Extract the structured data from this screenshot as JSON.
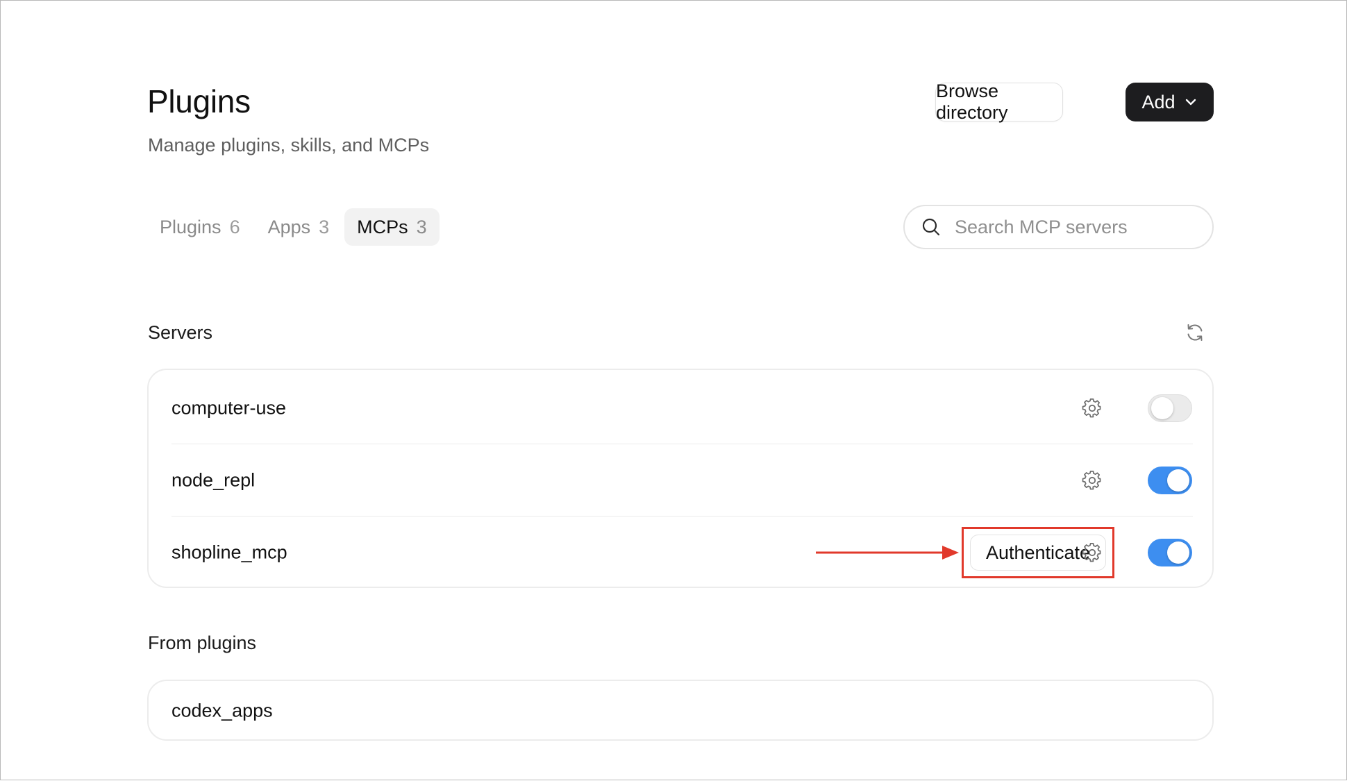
{
  "header": {
    "title": "Plugins",
    "subtitle": "Manage plugins, skills, and MCPs",
    "browse_label": "Browse directory",
    "add_label": "Add"
  },
  "tabs": [
    {
      "label": "Plugins",
      "count": "6",
      "active": false
    },
    {
      "label": "Apps",
      "count": "3",
      "active": false
    },
    {
      "label": "MCPs",
      "count": "3",
      "active": true
    }
  ],
  "search": {
    "placeholder": "Search MCP servers",
    "value": ""
  },
  "servers": {
    "title": "Servers",
    "items": [
      {
        "name": "computer-use",
        "enabled": false
      },
      {
        "name": "node_repl",
        "enabled": true
      },
      {
        "name": "shopline_mcp",
        "enabled": true,
        "action_label": "Authenticate"
      }
    ]
  },
  "from_plugins": {
    "title": "From plugins",
    "items": [
      {
        "name": "codex_apps"
      }
    ]
  },
  "colors": {
    "accent_toggle": "#3d8ef0",
    "annotation_red": "#e1392b",
    "primary_button": "#1d1d1f"
  },
  "icons": {
    "search": "search-icon",
    "refresh": "refresh-icon",
    "gear": "gear-icon",
    "chevron": "chevron-down-icon",
    "arrow": "arrow-right-icon"
  }
}
